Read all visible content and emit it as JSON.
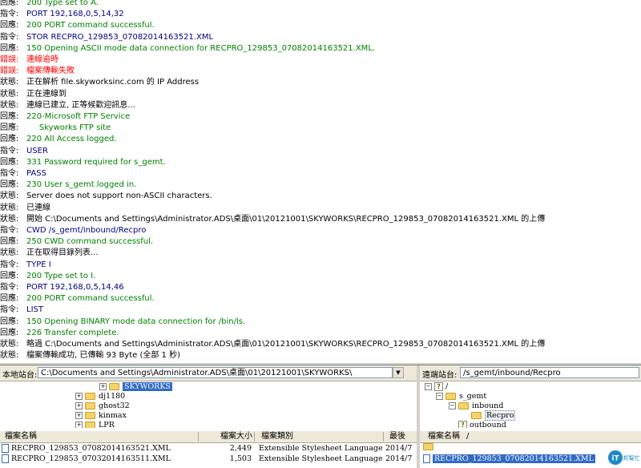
{
  "colors": {
    "status": "#000000",
    "command": "#000080",
    "response": "#008000",
    "error": "#ff0000"
  },
  "log": [
    {
      "label": "回應:",
      "text": "200 Type set to A.",
      "kind": "response"
    },
    {
      "label": "指令:",
      "text": "PORT 192,168,0,5,14,32",
      "kind": "command"
    },
    {
      "label": "回應:",
      "text": "200 PORT command successful.",
      "kind": "response"
    },
    {
      "label": "指令:",
      "text": "STOR RECPRO_129853_07082014163521.XML",
      "kind": "command"
    },
    {
      "label": "回應:",
      "text": "150 Opening ASCII mode data connection for RECPRO_129853_07082014163521.XML.",
      "kind": "response"
    },
    {
      "label": "錯誤:",
      "text": "連線逾時",
      "kind": "error"
    },
    {
      "label": "錯誤:",
      "text": "檔案傳輸失敗",
      "kind": "error"
    },
    {
      "label": "狀態:",
      "text": "正在解析 file.skyworksinc.com 的 IP Address",
      "kind": "status"
    },
    {
      "label": "狀態:",
      "text": "正在連線到",
      "kind": "status"
    },
    {
      "label": "狀態:",
      "text": "連線已建立, 正等候歡迎訊息...",
      "kind": "status"
    },
    {
      "label": "回應:",
      "text": "220-Microsoft FTP Service",
      "kind": "response"
    },
    {
      "label": "回應:",
      "text": "     Skyworks FTP site",
      "kind": "response"
    },
    {
      "label": "回應:",
      "text": "220 All Access logged.",
      "kind": "response"
    },
    {
      "label": "指令:",
      "text": "USER",
      "kind": "command"
    },
    {
      "label": "回應:",
      "text": "331 Password required for s_gemt.",
      "kind": "response"
    },
    {
      "label": "指令:",
      "text": "PASS",
      "kind": "command"
    },
    {
      "label": "回應:",
      "text": "230 User s_gemt logged in.",
      "kind": "response"
    },
    {
      "label": "狀態:",
      "text": "Server does not support non-ASCII characters.",
      "kind": "status"
    },
    {
      "label": "狀態:",
      "text": "已連線",
      "kind": "status"
    },
    {
      "label": "狀態:",
      "text": "開始 C:\\Documents and Settings\\Administrator.ADS\\桌面\\01\\20121001\\SKYWORKS\\RECPRO_129853_07082014163521.XML 的上傳",
      "kind": "status"
    },
    {
      "label": "指令:",
      "text": "CWD /s_gemt/inbound/Recpro",
      "kind": "command"
    },
    {
      "label": "回應:",
      "text": "250 CWD command successful.",
      "kind": "response"
    },
    {
      "label": "狀態:",
      "text": "正在取得目錄列表...",
      "kind": "status"
    },
    {
      "label": "指令:",
      "text": "TYPE I",
      "kind": "command"
    },
    {
      "label": "回應:",
      "text": "200 Type set to I.",
      "kind": "response"
    },
    {
      "label": "指令:",
      "text": "PORT 192,168,0,5,14,46",
      "kind": "command"
    },
    {
      "label": "回應:",
      "text": "200 PORT command successful.",
      "kind": "response"
    },
    {
      "label": "指令:",
      "text": "LIST",
      "kind": "command"
    },
    {
      "label": "回應:",
      "text": "150 Opening BINARY mode data connection for /bin/ls.",
      "kind": "response"
    },
    {
      "label": "回應:",
      "text": "226 Transfer complete.",
      "kind": "response"
    },
    {
      "label": "狀態:",
      "text": "略過 C:\\Documents and Settings\\Administrator.ADS\\桌面\\01\\20121001\\SKYWORKS\\RECPRO_129853_07082014163521.XML 的上傳",
      "kind": "status"
    },
    {
      "label": "狀態:",
      "text": "檔案傳輸成功, 已傳輸 93 Byte (全部 1 秒)",
      "kind": "status"
    }
  ],
  "local": {
    "site_label": "本地站台:",
    "path": "C:\\Documents and Settings\\Administrator.ADS\\桌面\\01\\20121001\\SKYWORKS\\",
    "tree": [
      {
        "label": "SKYWORKS",
        "selected": true
      },
      {
        "label": "dj1180"
      },
      {
        "label": "ghost32"
      },
      {
        "label": "kinmax"
      },
      {
        "label": "LPR"
      }
    ],
    "headers": {
      "name": "檔案名稱",
      "size": "檔案大小",
      "type": "檔案類別",
      "modified": "最後"
    },
    "files": [
      {
        "name": "RECPRO_129853_07082014163521.XML",
        "size": "2,449",
        "type": "Extensible Stylesheet Language",
        "modified": "2014/7"
      },
      {
        "name": "RECPRO_129853_07032014163511.XML",
        "size": "1,503",
        "type": "Extensible Stylesheet Language",
        "modified": "2014/7"
      }
    ]
  },
  "remote": {
    "site_label": "遠端站台:",
    "path": "/s_gemt/inbound/Recpro",
    "tree": [
      {
        "label": "/"
      },
      {
        "label": "s_gemt"
      },
      {
        "label": "inbound"
      },
      {
        "label": "Recpro"
      },
      {
        "label": "outbound"
      }
    ],
    "headers": {
      "name": "檔案名稱",
      "sort": "/"
    },
    "files": [
      {
        "name": ".."
      },
      {
        "name": "RECPRO_129853_07082014163521.XML"
      }
    ]
  },
  "watermark": {
    "text": "iT邦幫忙"
  }
}
